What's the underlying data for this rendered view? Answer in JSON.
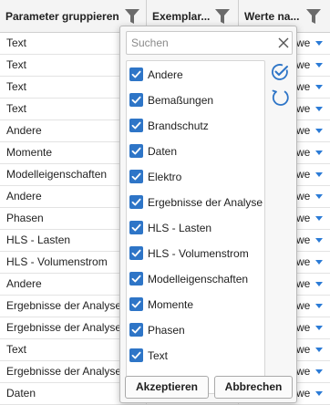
{
  "header": {
    "col1": "Parameter gruppieren",
    "col2": "Exemplar...",
    "col3": "Werte na..."
  },
  "rows": [
    {
      "group": "Text",
      "value": "we"
    },
    {
      "group": "Text",
      "value": "we"
    },
    {
      "group": "Text",
      "value": "we"
    },
    {
      "group": "Text",
      "value": "we"
    },
    {
      "group": "Andere",
      "value": "we"
    },
    {
      "group": "Momente",
      "value": "we"
    },
    {
      "group": "Modelleigenschaften",
      "value": "we"
    },
    {
      "group": "Andere",
      "value": "we"
    },
    {
      "group": "Phasen",
      "value": "we"
    },
    {
      "group": "HLS - Lasten",
      "value": "we"
    },
    {
      "group": "HLS - Volumenstrom",
      "value": "we"
    },
    {
      "group": "Andere",
      "value": "we"
    },
    {
      "group": "Ergebnisse der Analyse",
      "value": "we"
    },
    {
      "group": "Ergebnisse der Analyse",
      "value": "we"
    },
    {
      "group": "Text",
      "value": "we"
    },
    {
      "group": "Ergebnisse der Analyse",
      "value": "we"
    },
    {
      "group": "Daten",
      "value": "we"
    }
  ],
  "filter_popup": {
    "search_placeholder": "Suchen",
    "items": [
      {
        "label": "Andere",
        "checked": true
      },
      {
        "label": "Bemaßungen",
        "checked": true
      },
      {
        "label": "Brandschutz",
        "checked": true
      },
      {
        "label": "Daten",
        "checked": true
      },
      {
        "label": "Elektro",
        "checked": true
      },
      {
        "label": "Ergebnisse der Analyse",
        "checked": true
      },
      {
        "label": "HLS - Lasten",
        "checked": true
      },
      {
        "label": "HLS - Volumenstrom",
        "checked": true
      },
      {
        "label": "Modelleigenschaften",
        "checked": true
      },
      {
        "label": "Momente",
        "checked": true
      },
      {
        "label": "Phasen",
        "checked": true
      },
      {
        "label": "Text",
        "checked": true
      }
    ],
    "accept_label": "Akzeptieren",
    "cancel_label": "Abbrechen"
  },
  "colors": {
    "accent": "#2e75c7",
    "dropdown_arrow": "#2b7bd6",
    "filter_icon": "#6b6b6b"
  },
  "icons": {
    "filter": "filter-funnel-icon",
    "clear": "close-icon",
    "select_all": "select-all-check-icon",
    "deselect_all": "deselect-all-circle-icon",
    "dropdown": "chevron-down-icon",
    "checkbox": "checkmark-icon"
  }
}
